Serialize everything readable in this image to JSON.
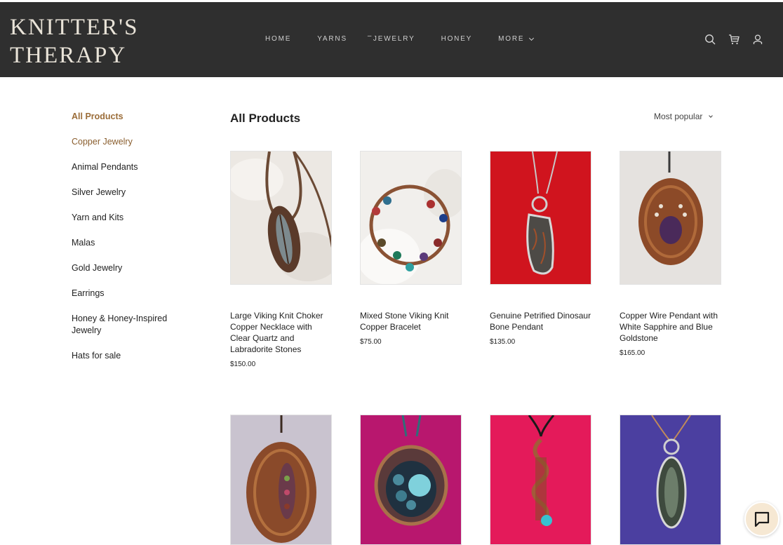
{
  "brand": {
    "line1": "KNITTER'S",
    "line2": "THERAPY"
  },
  "nav": {
    "home": "HOME",
    "yarns": "YARNS",
    "jewelry_dash": "–",
    "jewelry": "JEWELRY",
    "honey": "HONEY",
    "more": "MORE"
  },
  "header_icons": [
    "search-icon",
    "cart-icon",
    "account-icon"
  ],
  "sidebar": {
    "items": [
      {
        "label": "All Products"
      },
      {
        "label": "Copper Jewelry"
      },
      {
        "label": "Animal Pendants"
      },
      {
        "label": "Silver Jewelry"
      },
      {
        "label": "Yarn and Kits"
      },
      {
        "label": "Malas"
      },
      {
        "label": "Gold Jewelry"
      },
      {
        "label": "Earrings"
      },
      {
        "label": "Honey & Honey-Inspired Jewelry"
      },
      {
        "label": "Hats for sale"
      }
    ]
  },
  "main": {
    "title": "All Products",
    "sort": "Most popular"
  },
  "products": [
    {
      "name": "Large Viking Knit Choker Copper Necklace with Clear Quartz and Labradorite Stones",
      "price": "$150.00"
    },
    {
      "name": "Mixed Stone Viking Knit Copper Bracelet",
      "price": "$75.00"
    },
    {
      "name": "Genuine Petrified Dinosaur Bone Pendant",
      "price": "$135.00"
    },
    {
      "name": "Copper Wire Pendant with White Sapphire and Blue Goldstone",
      "price": "$165.00"
    }
  ],
  "colors": {
    "header_bg": "#2f2f2f",
    "accent": "#9b6d39",
    "chat_bg": "#f6e8d3"
  }
}
